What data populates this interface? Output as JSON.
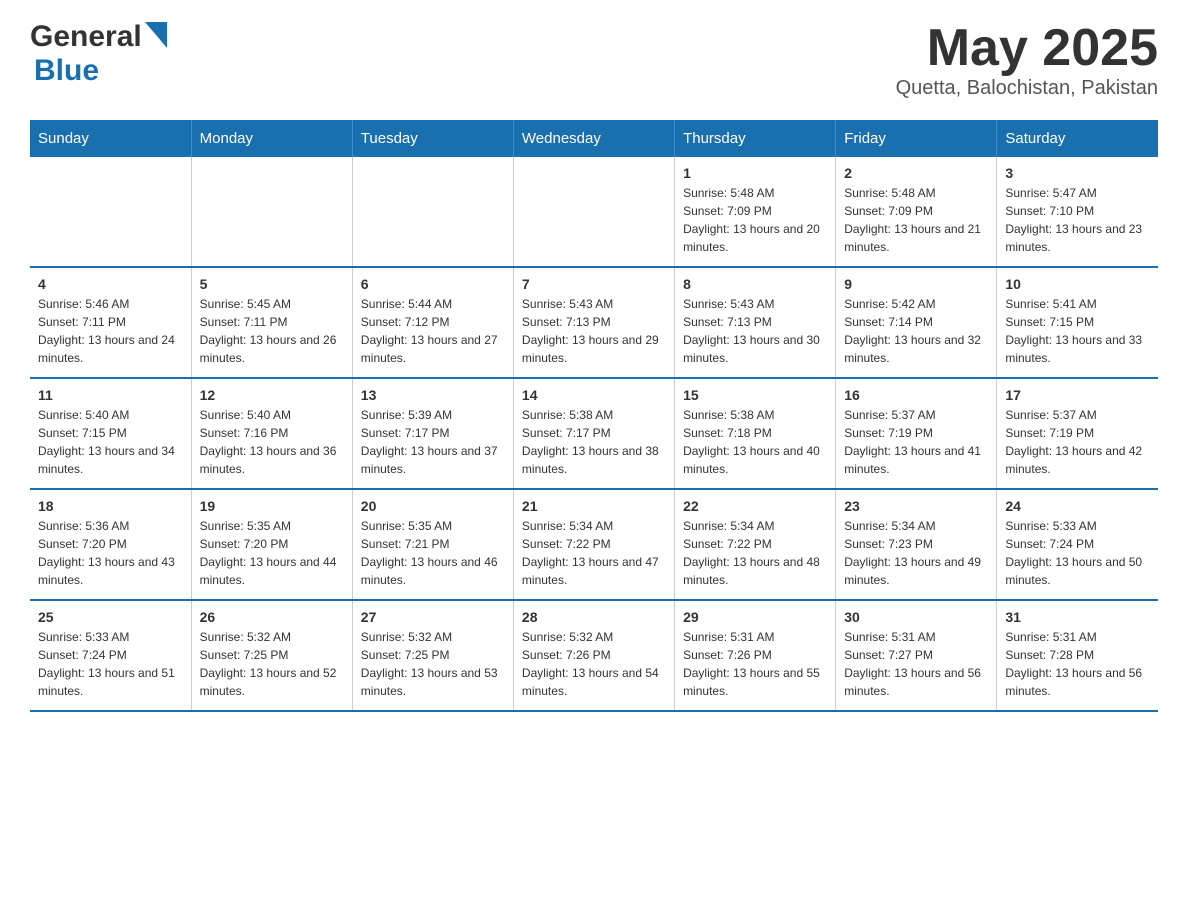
{
  "header": {
    "logo_general": "General",
    "logo_blue": "Blue",
    "month_title": "May 2025",
    "location": "Quetta, Balochistan, Pakistan"
  },
  "days_of_week": [
    "Sunday",
    "Monday",
    "Tuesday",
    "Wednesday",
    "Thursday",
    "Friday",
    "Saturday"
  ],
  "weeks": [
    [
      {
        "day": "",
        "info": ""
      },
      {
        "day": "",
        "info": ""
      },
      {
        "day": "",
        "info": ""
      },
      {
        "day": "",
        "info": ""
      },
      {
        "day": "1",
        "info": "Sunrise: 5:48 AM\nSunset: 7:09 PM\nDaylight: 13 hours and 20 minutes."
      },
      {
        "day": "2",
        "info": "Sunrise: 5:48 AM\nSunset: 7:09 PM\nDaylight: 13 hours and 21 minutes."
      },
      {
        "day": "3",
        "info": "Sunrise: 5:47 AM\nSunset: 7:10 PM\nDaylight: 13 hours and 23 minutes."
      }
    ],
    [
      {
        "day": "4",
        "info": "Sunrise: 5:46 AM\nSunset: 7:11 PM\nDaylight: 13 hours and 24 minutes."
      },
      {
        "day": "5",
        "info": "Sunrise: 5:45 AM\nSunset: 7:11 PM\nDaylight: 13 hours and 26 minutes."
      },
      {
        "day": "6",
        "info": "Sunrise: 5:44 AM\nSunset: 7:12 PM\nDaylight: 13 hours and 27 minutes."
      },
      {
        "day": "7",
        "info": "Sunrise: 5:43 AM\nSunset: 7:13 PM\nDaylight: 13 hours and 29 minutes."
      },
      {
        "day": "8",
        "info": "Sunrise: 5:43 AM\nSunset: 7:13 PM\nDaylight: 13 hours and 30 minutes."
      },
      {
        "day": "9",
        "info": "Sunrise: 5:42 AM\nSunset: 7:14 PM\nDaylight: 13 hours and 32 minutes."
      },
      {
        "day": "10",
        "info": "Sunrise: 5:41 AM\nSunset: 7:15 PM\nDaylight: 13 hours and 33 minutes."
      }
    ],
    [
      {
        "day": "11",
        "info": "Sunrise: 5:40 AM\nSunset: 7:15 PM\nDaylight: 13 hours and 34 minutes."
      },
      {
        "day": "12",
        "info": "Sunrise: 5:40 AM\nSunset: 7:16 PM\nDaylight: 13 hours and 36 minutes."
      },
      {
        "day": "13",
        "info": "Sunrise: 5:39 AM\nSunset: 7:17 PM\nDaylight: 13 hours and 37 minutes."
      },
      {
        "day": "14",
        "info": "Sunrise: 5:38 AM\nSunset: 7:17 PM\nDaylight: 13 hours and 38 minutes."
      },
      {
        "day": "15",
        "info": "Sunrise: 5:38 AM\nSunset: 7:18 PM\nDaylight: 13 hours and 40 minutes."
      },
      {
        "day": "16",
        "info": "Sunrise: 5:37 AM\nSunset: 7:19 PM\nDaylight: 13 hours and 41 minutes."
      },
      {
        "day": "17",
        "info": "Sunrise: 5:37 AM\nSunset: 7:19 PM\nDaylight: 13 hours and 42 minutes."
      }
    ],
    [
      {
        "day": "18",
        "info": "Sunrise: 5:36 AM\nSunset: 7:20 PM\nDaylight: 13 hours and 43 minutes."
      },
      {
        "day": "19",
        "info": "Sunrise: 5:35 AM\nSunset: 7:20 PM\nDaylight: 13 hours and 44 minutes."
      },
      {
        "day": "20",
        "info": "Sunrise: 5:35 AM\nSunset: 7:21 PM\nDaylight: 13 hours and 46 minutes."
      },
      {
        "day": "21",
        "info": "Sunrise: 5:34 AM\nSunset: 7:22 PM\nDaylight: 13 hours and 47 minutes."
      },
      {
        "day": "22",
        "info": "Sunrise: 5:34 AM\nSunset: 7:22 PM\nDaylight: 13 hours and 48 minutes."
      },
      {
        "day": "23",
        "info": "Sunrise: 5:34 AM\nSunset: 7:23 PM\nDaylight: 13 hours and 49 minutes."
      },
      {
        "day": "24",
        "info": "Sunrise: 5:33 AM\nSunset: 7:24 PM\nDaylight: 13 hours and 50 minutes."
      }
    ],
    [
      {
        "day": "25",
        "info": "Sunrise: 5:33 AM\nSunset: 7:24 PM\nDaylight: 13 hours and 51 minutes."
      },
      {
        "day": "26",
        "info": "Sunrise: 5:32 AM\nSunset: 7:25 PM\nDaylight: 13 hours and 52 minutes."
      },
      {
        "day": "27",
        "info": "Sunrise: 5:32 AM\nSunset: 7:25 PM\nDaylight: 13 hours and 53 minutes."
      },
      {
        "day": "28",
        "info": "Sunrise: 5:32 AM\nSunset: 7:26 PM\nDaylight: 13 hours and 54 minutes."
      },
      {
        "day": "29",
        "info": "Sunrise: 5:31 AM\nSunset: 7:26 PM\nDaylight: 13 hours and 55 minutes."
      },
      {
        "day": "30",
        "info": "Sunrise: 5:31 AM\nSunset: 7:27 PM\nDaylight: 13 hours and 56 minutes."
      },
      {
        "day": "31",
        "info": "Sunrise: 5:31 AM\nSunset: 7:28 PM\nDaylight: 13 hours and 56 minutes."
      }
    ]
  ]
}
